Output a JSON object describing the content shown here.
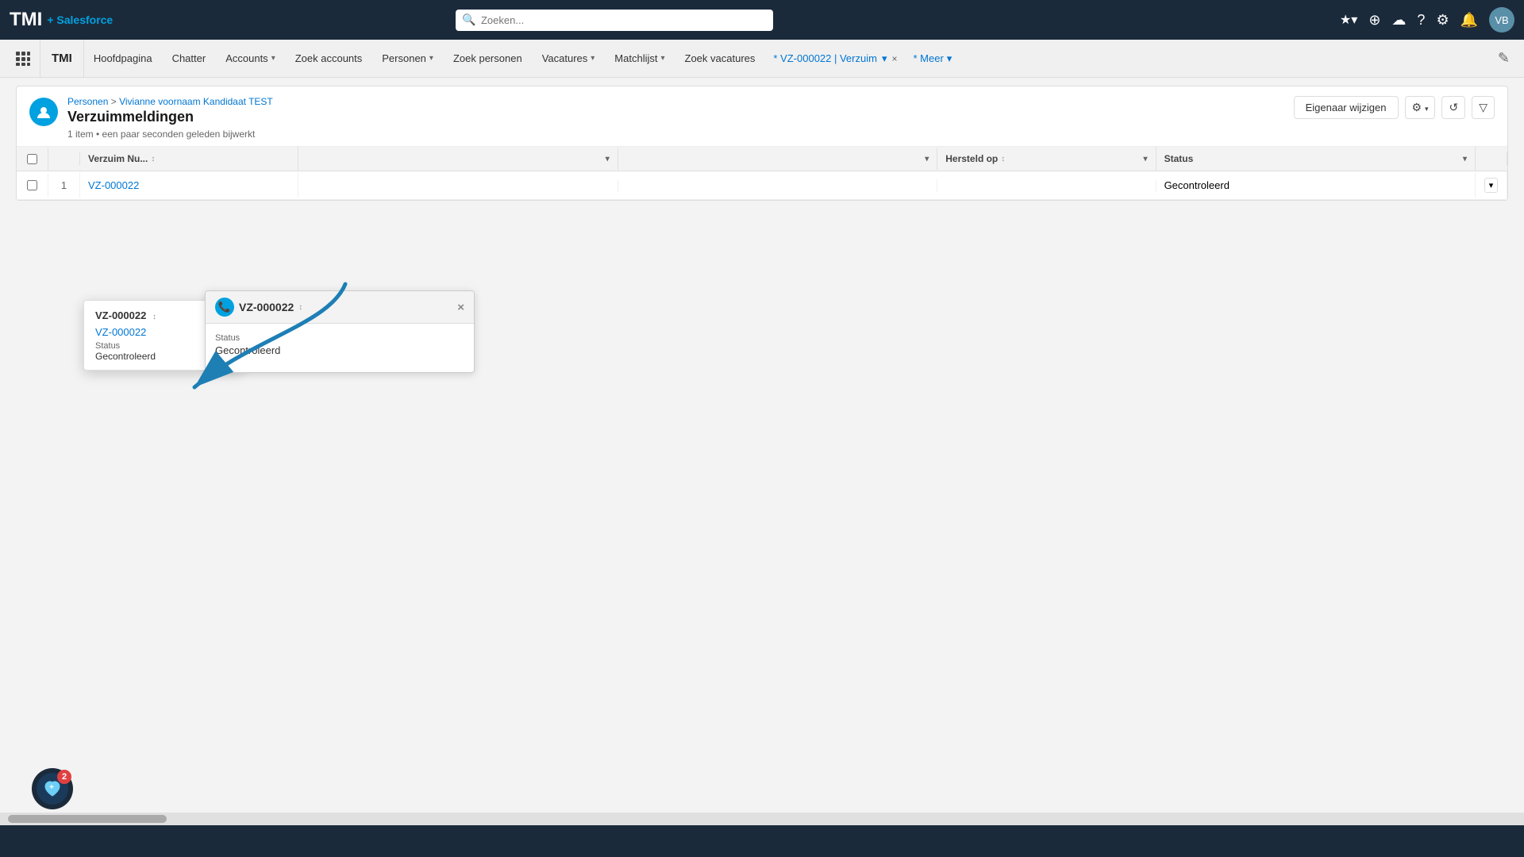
{
  "topbar": {
    "logo_tmi": "TMI",
    "logo_salesforce": "+ Salesforce",
    "search_placeholder": "Zoeken...",
    "icons": [
      "★▾",
      "⊕",
      "☁",
      "?",
      "⚙",
      "🔔"
    ],
    "avatar_initials": "VB"
  },
  "navbar": {
    "app_name": "TMI",
    "items": [
      {
        "id": "hoofdpagina",
        "label": "Hoofdpagina",
        "has_chevron": false
      },
      {
        "id": "chatter",
        "label": "Chatter",
        "has_chevron": false
      },
      {
        "id": "accounts",
        "label": "Accounts",
        "has_chevron": true
      },
      {
        "id": "zoek-accounts",
        "label": "Zoek accounts",
        "has_chevron": false
      },
      {
        "id": "personen",
        "label": "Personen",
        "has_chevron": true
      },
      {
        "id": "zoek-personen",
        "label": "Zoek personen",
        "has_chevron": false
      },
      {
        "id": "vacatures",
        "label": "Vacatures",
        "has_chevron": true
      },
      {
        "id": "matchlijst",
        "label": "Matchlijst",
        "has_chevron": true
      },
      {
        "id": "zoek-vacatures",
        "label": "Zoek vacatures",
        "has_chevron": false
      }
    ],
    "special_tab": "* VZ-000022 | Verzuim",
    "more_label": "* Meer",
    "end_icon": "✎"
  },
  "page": {
    "breadcrumb_link": "Personen",
    "breadcrumb_sep": ">",
    "breadcrumb_person": "Vivianne voornaam Kandidaat TEST",
    "title": "Verzuimmeldingen",
    "subtitle": "1 item • een paar seconden geleden bijwerkt",
    "btn_eigenaar": "Eigenaar wijzigen",
    "gear_icon": "⚙",
    "refresh_icon": "↺",
    "filter_icon": "▽"
  },
  "table": {
    "columns": [
      {
        "id": "checkbox",
        "label": ""
      },
      {
        "id": "num",
        "label": ""
      },
      {
        "id": "verzuim",
        "label": "Verzuim Nu..."
      },
      {
        "id": "col3",
        "label": ""
      },
      {
        "id": "col4",
        "label": ""
      },
      {
        "id": "hersteld",
        "label": "Hersteld op"
      },
      {
        "id": "status",
        "label": "Status"
      },
      {
        "id": "actions",
        "label": ""
      }
    ],
    "rows": [
      {
        "num": "1",
        "verzuim_link": "VZ-000022",
        "col3": "",
        "col4": "",
        "hersteld": "",
        "status": "Gecontroleerd",
        "action": "▾"
      }
    ]
  },
  "popup_small": {
    "title": "VZ-000022",
    "title_sort": "↕",
    "link": "VZ-000022",
    "status_label": "Status",
    "status_value": "Gecontroleerd",
    "close_icon": "×"
  },
  "popup_large": {
    "title": "VZ-000022",
    "title_sort": "↕",
    "close_icon": "×",
    "icon": "📞"
  },
  "floating_badge": {
    "icon": "♥",
    "count": "2"
  },
  "colors": {
    "brand_blue": "#0176d3",
    "topbar_bg": "#1b2a3b",
    "nav_bg": "#f0f0f0",
    "accent": "#00a1e0"
  }
}
